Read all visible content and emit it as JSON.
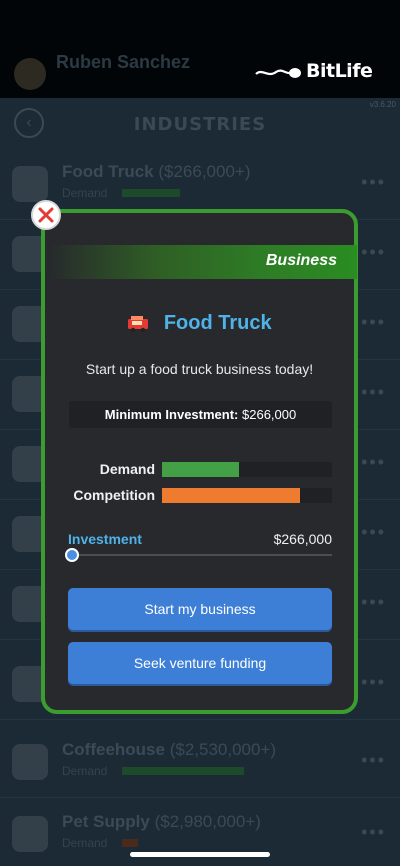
{
  "header": {
    "player_name": "Ruben Sanchez",
    "player_sub": "",
    "logo_text": "BitLife",
    "version": "v3.6.20"
  },
  "page": {
    "title": "INDUSTRIES"
  },
  "background_list": [
    {
      "name": "Food Truck",
      "price": "($266,000+)",
      "demand_label": "Demand",
      "demand": 0.45
    },
    {
      "name": "",
      "price": "",
      "demand_label": "",
      "demand": 0
    },
    {
      "name": "",
      "price": "",
      "demand_label": "",
      "demand": 0
    },
    {
      "name": "",
      "price": "",
      "demand_label": "",
      "demand": 0
    },
    {
      "name": "",
      "price": "",
      "demand_label": "",
      "demand": 0
    },
    {
      "name": "",
      "price": "",
      "demand_label": "",
      "demand": 0
    },
    {
      "name": "",
      "price": "",
      "demand_label": "",
      "demand": 0
    },
    {
      "name": "",
      "price": "",
      "demand_label": "",
      "demand": 0
    },
    {
      "name": "Coffeehouse",
      "price": "($2,530,000+)",
      "demand_label": "Demand",
      "demand": 0.8
    },
    {
      "name": "Pet Supply",
      "price": "($2,980,000+)",
      "demand_label": "Demand",
      "demand": 0.1
    }
  ],
  "modal": {
    "banner": "Business",
    "title": "Food Truck",
    "description": "Start up a food truck business today!",
    "min_investment_label": "Minimum Investment:",
    "min_investment_value": "$266,000",
    "meters": {
      "demand_label": "Demand",
      "demand_level": 0.45,
      "demand_color": "#43a047",
      "competition_label": "Competition",
      "competition_level": 0.81,
      "competition_color": "#ef7b2f"
    },
    "investment_label": "Investment",
    "investment_value": "$266,000",
    "investment_slider_level": 0,
    "start_button": "Start my business",
    "funding_button": "Seek venture funding"
  },
  "colors": {
    "accent_blue": "#4fb3ea",
    "button_blue": "#3d7fd6",
    "border_green": "#3b9d2f",
    "close_red": "#e53935"
  },
  "icons": {
    "close": "close-x-icon",
    "back": "chevron-left-icon",
    "food_truck": "food-truck-icon",
    "more": "more-dots-icon"
  }
}
